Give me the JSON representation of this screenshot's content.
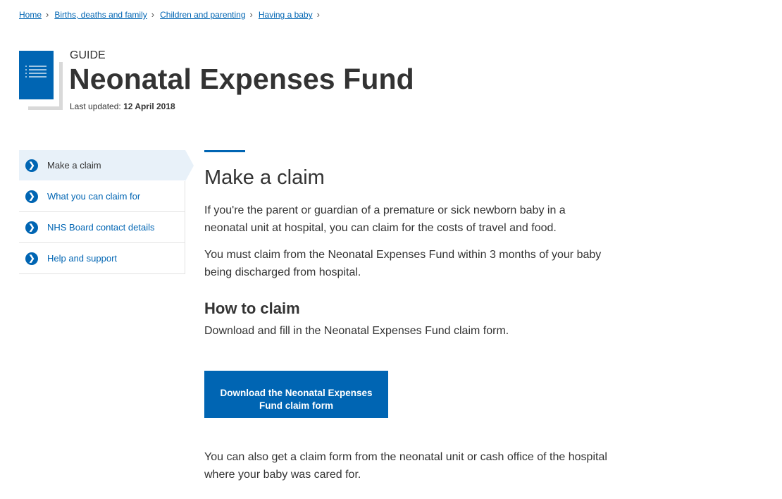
{
  "breadcrumb": {
    "items": [
      "Home",
      "Births, deaths and family",
      "Children and parenting",
      "Having a baby"
    ],
    "separator": "›"
  },
  "header": {
    "guide_label": "GUIDE",
    "title": "Neonatal Expenses Fund",
    "last_updated_label": "Last updated:",
    "last_updated_value": "12 April 2018",
    "icon": "document-list-icon"
  },
  "side_nav": {
    "bullet_glyph": "❯",
    "items": [
      {
        "label": "Make a claim",
        "current": true
      },
      {
        "label": "What you can claim for",
        "current": false
      },
      {
        "label": "NHS Board contact details",
        "current": false
      },
      {
        "label": "Help and support",
        "current": false
      }
    ]
  },
  "main": {
    "section_title": "Make a claim",
    "intro_1": "If you're the parent or guardian of a premature or sick newborn baby in a neonatal unit at hospital, you can claim for the costs of travel and food.",
    "intro_2": "You must claim from the Neonatal Expenses Fund within 3 months of your baby being discharged from hospital.",
    "how_title": "How to claim",
    "how_text": "Download and fill in the Neonatal Expenses Fund claim form.",
    "download_button": "Download the Neonatal Expenses Fund claim form",
    "extra_text": "You can also get a claim form from the neonatal unit or cash office of the hospital where your baby was cared for."
  },
  "colors": {
    "accent": "#0065b3",
    "text": "#333333",
    "current_nav_bg": "#e8f1f9"
  }
}
